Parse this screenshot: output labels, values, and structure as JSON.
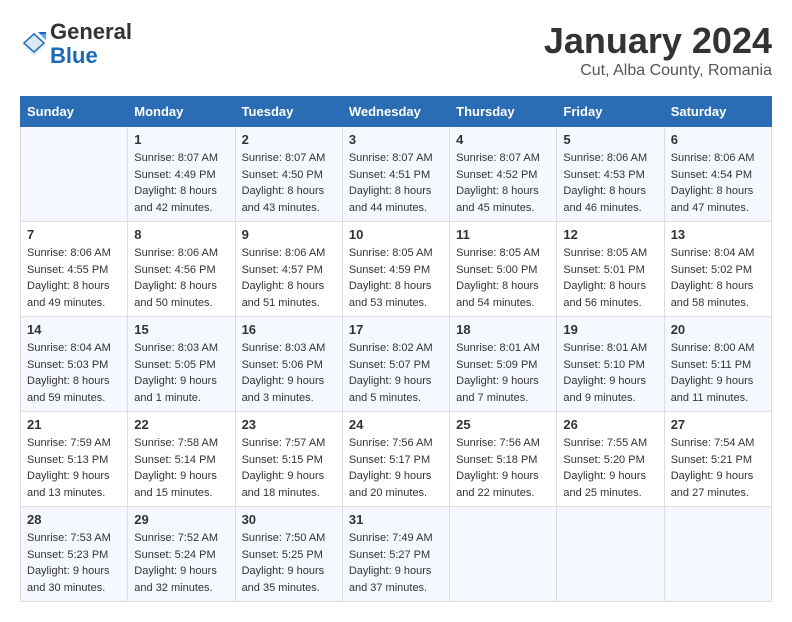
{
  "header": {
    "logo_general": "General",
    "logo_blue": "Blue",
    "month_title": "January 2024",
    "location": "Cut, Alba County, Romania"
  },
  "days_of_week": [
    "Sunday",
    "Monday",
    "Tuesday",
    "Wednesday",
    "Thursday",
    "Friday",
    "Saturday"
  ],
  "weeks": [
    [
      {
        "day": "",
        "info": ""
      },
      {
        "day": "1",
        "info": "Sunrise: 8:07 AM\nSunset: 4:49 PM\nDaylight: 8 hours\nand 42 minutes."
      },
      {
        "day": "2",
        "info": "Sunrise: 8:07 AM\nSunset: 4:50 PM\nDaylight: 8 hours\nand 43 minutes."
      },
      {
        "day": "3",
        "info": "Sunrise: 8:07 AM\nSunset: 4:51 PM\nDaylight: 8 hours\nand 44 minutes."
      },
      {
        "day": "4",
        "info": "Sunrise: 8:07 AM\nSunset: 4:52 PM\nDaylight: 8 hours\nand 45 minutes."
      },
      {
        "day": "5",
        "info": "Sunrise: 8:06 AM\nSunset: 4:53 PM\nDaylight: 8 hours\nand 46 minutes."
      },
      {
        "day": "6",
        "info": "Sunrise: 8:06 AM\nSunset: 4:54 PM\nDaylight: 8 hours\nand 47 minutes."
      }
    ],
    [
      {
        "day": "7",
        "info": "Sunrise: 8:06 AM\nSunset: 4:55 PM\nDaylight: 8 hours\nand 49 minutes."
      },
      {
        "day": "8",
        "info": "Sunrise: 8:06 AM\nSunset: 4:56 PM\nDaylight: 8 hours\nand 50 minutes."
      },
      {
        "day": "9",
        "info": "Sunrise: 8:06 AM\nSunset: 4:57 PM\nDaylight: 8 hours\nand 51 minutes."
      },
      {
        "day": "10",
        "info": "Sunrise: 8:05 AM\nSunset: 4:59 PM\nDaylight: 8 hours\nand 53 minutes."
      },
      {
        "day": "11",
        "info": "Sunrise: 8:05 AM\nSunset: 5:00 PM\nDaylight: 8 hours\nand 54 minutes."
      },
      {
        "day": "12",
        "info": "Sunrise: 8:05 AM\nSunset: 5:01 PM\nDaylight: 8 hours\nand 56 minutes."
      },
      {
        "day": "13",
        "info": "Sunrise: 8:04 AM\nSunset: 5:02 PM\nDaylight: 8 hours\nand 58 minutes."
      }
    ],
    [
      {
        "day": "14",
        "info": "Sunrise: 8:04 AM\nSunset: 5:03 PM\nDaylight: 8 hours\nand 59 minutes."
      },
      {
        "day": "15",
        "info": "Sunrise: 8:03 AM\nSunset: 5:05 PM\nDaylight: 9 hours\nand 1 minute."
      },
      {
        "day": "16",
        "info": "Sunrise: 8:03 AM\nSunset: 5:06 PM\nDaylight: 9 hours\nand 3 minutes."
      },
      {
        "day": "17",
        "info": "Sunrise: 8:02 AM\nSunset: 5:07 PM\nDaylight: 9 hours\nand 5 minutes."
      },
      {
        "day": "18",
        "info": "Sunrise: 8:01 AM\nSunset: 5:09 PM\nDaylight: 9 hours\nand 7 minutes."
      },
      {
        "day": "19",
        "info": "Sunrise: 8:01 AM\nSunset: 5:10 PM\nDaylight: 9 hours\nand 9 minutes."
      },
      {
        "day": "20",
        "info": "Sunrise: 8:00 AM\nSunset: 5:11 PM\nDaylight: 9 hours\nand 11 minutes."
      }
    ],
    [
      {
        "day": "21",
        "info": "Sunrise: 7:59 AM\nSunset: 5:13 PM\nDaylight: 9 hours\nand 13 minutes."
      },
      {
        "day": "22",
        "info": "Sunrise: 7:58 AM\nSunset: 5:14 PM\nDaylight: 9 hours\nand 15 minutes."
      },
      {
        "day": "23",
        "info": "Sunrise: 7:57 AM\nSunset: 5:15 PM\nDaylight: 9 hours\nand 18 minutes."
      },
      {
        "day": "24",
        "info": "Sunrise: 7:56 AM\nSunset: 5:17 PM\nDaylight: 9 hours\nand 20 minutes."
      },
      {
        "day": "25",
        "info": "Sunrise: 7:56 AM\nSunset: 5:18 PM\nDaylight: 9 hours\nand 22 minutes."
      },
      {
        "day": "26",
        "info": "Sunrise: 7:55 AM\nSunset: 5:20 PM\nDaylight: 9 hours\nand 25 minutes."
      },
      {
        "day": "27",
        "info": "Sunrise: 7:54 AM\nSunset: 5:21 PM\nDaylight: 9 hours\nand 27 minutes."
      }
    ],
    [
      {
        "day": "28",
        "info": "Sunrise: 7:53 AM\nSunset: 5:23 PM\nDaylight: 9 hours\nand 30 minutes."
      },
      {
        "day": "29",
        "info": "Sunrise: 7:52 AM\nSunset: 5:24 PM\nDaylight: 9 hours\nand 32 minutes."
      },
      {
        "day": "30",
        "info": "Sunrise: 7:50 AM\nSunset: 5:25 PM\nDaylight: 9 hours\nand 35 minutes."
      },
      {
        "day": "31",
        "info": "Sunrise: 7:49 AM\nSunset: 5:27 PM\nDaylight: 9 hours\nand 37 minutes."
      },
      {
        "day": "",
        "info": ""
      },
      {
        "day": "",
        "info": ""
      },
      {
        "day": "",
        "info": ""
      }
    ]
  ]
}
